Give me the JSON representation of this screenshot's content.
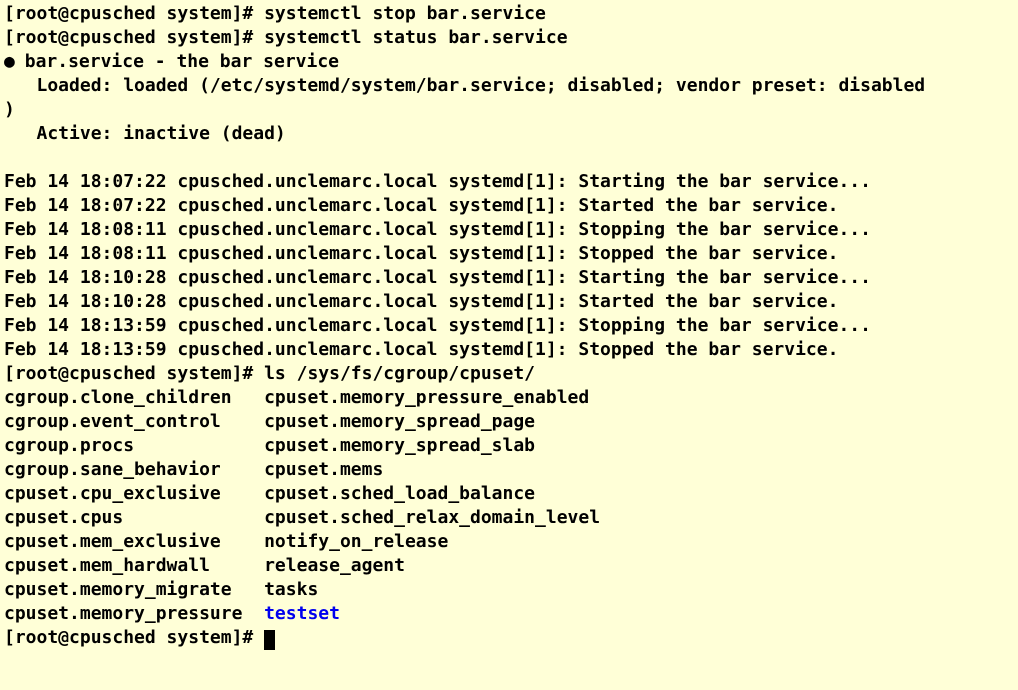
{
  "prompt1": "[root@cpusched system]# ",
  "cmd_stop": "systemctl stop bar.service",
  "cmd_status": "systemctl status bar.service",
  "status_header": " bar.service - the bar service",
  "status_loaded": "   Loaded: loaded (/etc/systemd/system/bar.service; disabled; vendor preset: disabled",
  "status_wrap": ")",
  "status_active": "   Active: inactive (dead)",
  "log1": "Feb 14 18:07:22 cpusched.unclemarc.local systemd[1]: Starting the bar service...",
  "log2": "Feb 14 18:07:22 cpusched.unclemarc.local systemd[1]: Started the bar service.",
  "log3": "Feb 14 18:08:11 cpusched.unclemarc.local systemd[1]: Stopping the bar service...",
  "log4": "Feb 14 18:08:11 cpusched.unclemarc.local systemd[1]: Stopped the bar service.",
  "log5": "Feb 14 18:10:28 cpusched.unclemarc.local systemd[1]: Starting the bar service...",
  "log6": "Feb 14 18:10:28 cpusched.unclemarc.local systemd[1]: Started the bar service.",
  "log7": "Feb 14 18:13:59 cpusched.unclemarc.local systemd[1]: Stopping the bar service...",
  "log8": "Feb 14 18:13:59 cpusched.unclemarc.local systemd[1]: Stopped the bar service.",
  "cmd_ls": "ls /sys/fs/cgroup/cpuset/",
  "ls_row1a": "cgroup.clone_children   ",
  "ls_row1b": "cpuset.memory_pressure_enabled",
  "ls_row2a": "cgroup.event_control    ",
  "ls_row2b": "cpuset.memory_spread_page",
  "ls_row3a": "cgroup.procs            ",
  "ls_row3b": "cpuset.memory_spread_slab",
  "ls_row4a": "cgroup.sane_behavior    ",
  "ls_row4b": "cpuset.mems",
  "ls_row5a": "cpuset.cpu_exclusive    ",
  "ls_row5b": "cpuset.sched_load_balance",
  "ls_row6a": "cpuset.cpus             ",
  "ls_row6b": "cpuset.sched_relax_domain_level",
  "ls_row7a": "cpuset.mem_exclusive    ",
  "ls_row7b": "notify_on_release",
  "ls_row8a": "cpuset.mem_hardwall     ",
  "ls_row8b": "release_agent",
  "ls_row9a": "cpuset.memory_migrate   ",
  "ls_row9b": "tasks",
  "ls_row10a": "cpuset.memory_pressure  ",
  "ls_row10b": "testset",
  "bullet": "●"
}
